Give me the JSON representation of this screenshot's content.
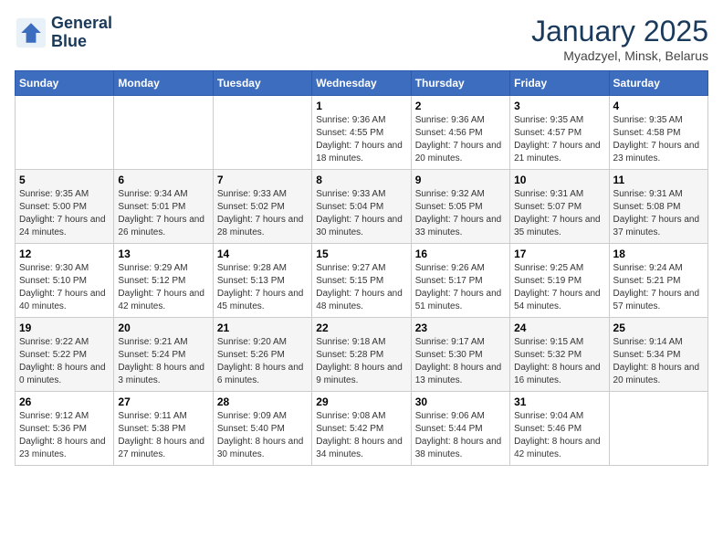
{
  "logo": {
    "line1": "General",
    "line2": "Blue"
  },
  "title": "January 2025",
  "location": "Myadzyel, Minsk, Belarus",
  "weekdays": [
    "Sunday",
    "Monday",
    "Tuesday",
    "Wednesday",
    "Thursday",
    "Friday",
    "Saturday"
  ],
  "weeks": [
    [
      {
        "day": "",
        "sunrise": "",
        "sunset": "",
        "daylight": ""
      },
      {
        "day": "",
        "sunrise": "",
        "sunset": "",
        "daylight": ""
      },
      {
        "day": "",
        "sunrise": "",
        "sunset": "",
        "daylight": ""
      },
      {
        "day": "1",
        "sunrise": "Sunrise: 9:36 AM",
        "sunset": "Sunset: 4:55 PM",
        "daylight": "Daylight: 7 hours and 18 minutes."
      },
      {
        "day": "2",
        "sunrise": "Sunrise: 9:36 AM",
        "sunset": "Sunset: 4:56 PM",
        "daylight": "Daylight: 7 hours and 20 minutes."
      },
      {
        "day": "3",
        "sunrise": "Sunrise: 9:35 AM",
        "sunset": "Sunset: 4:57 PM",
        "daylight": "Daylight: 7 hours and 21 minutes."
      },
      {
        "day": "4",
        "sunrise": "Sunrise: 9:35 AM",
        "sunset": "Sunset: 4:58 PM",
        "daylight": "Daylight: 7 hours and 23 minutes."
      }
    ],
    [
      {
        "day": "5",
        "sunrise": "Sunrise: 9:35 AM",
        "sunset": "Sunset: 5:00 PM",
        "daylight": "Daylight: 7 hours and 24 minutes."
      },
      {
        "day": "6",
        "sunrise": "Sunrise: 9:34 AM",
        "sunset": "Sunset: 5:01 PM",
        "daylight": "Daylight: 7 hours and 26 minutes."
      },
      {
        "day": "7",
        "sunrise": "Sunrise: 9:33 AM",
        "sunset": "Sunset: 5:02 PM",
        "daylight": "Daylight: 7 hours and 28 minutes."
      },
      {
        "day": "8",
        "sunrise": "Sunrise: 9:33 AM",
        "sunset": "Sunset: 5:04 PM",
        "daylight": "Daylight: 7 hours and 30 minutes."
      },
      {
        "day": "9",
        "sunrise": "Sunrise: 9:32 AM",
        "sunset": "Sunset: 5:05 PM",
        "daylight": "Daylight: 7 hours and 33 minutes."
      },
      {
        "day": "10",
        "sunrise": "Sunrise: 9:31 AM",
        "sunset": "Sunset: 5:07 PM",
        "daylight": "Daylight: 7 hours and 35 minutes."
      },
      {
        "day": "11",
        "sunrise": "Sunrise: 9:31 AM",
        "sunset": "Sunset: 5:08 PM",
        "daylight": "Daylight: 7 hours and 37 minutes."
      }
    ],
    [
      {
        "day": "12",
        "sunrise": "Sunrise: 9:30 AM",
        "sunset": "Sunset: 5:10 PM",
        "daylight": "Daylight: 7 hours and 40 minutes."
      },
      {
        "day": "13",
        "sunrise": "Sunrise: 9:29 AM",
        "sunset": "Sunset: 5:12 PM",
        "daylight": "Daylight: 7 hours and 42 minutes."
      },
      {
        "day": "14",
        "sunrise": "Sunrise: 9:28 AM",
        "sunset": "Sunset: 5:13 PM",
        "daylight": "Daylight: 7 hours and 45 minutes."
      },
      {
        "day": "15",
        "sunrise": "Sunrise: 9:27 AM",
        "sunset": "Sunset: 5:15 PM",
        "daylight": "Daylight: 7 hours and 48 minutes."
      },
      {
        "day": "16",
        "sunrise": "Sunrise: 9:26 AM",
        "sunset": "Sunset: 5:17 PM",
        "daylight": "Daylight: 7 hours and 51 minutes."
      },
      {
        "day": "17",
        "sunrise": "Sunrise: 9:25 AM",
        "sunset": "Sunset: 5:19 PM",
        "daylight": "Daylight: 7 hours and 54 minutes."
      },
      {
        "day": "18",
        "sunrise": "Sunrise: 9:24 AM",
        "sunset": "Sunset: 5:21 PM",
        "daylight": "Daylight: 7 hours and 57 minutes."
      }
    ],
    [
      {
        "day": "19",
        "sunrise": "Sunrise: 9:22 AM",
        "sunset": "Sunset: 5:22 PM",
        "daylight": "Daylight: 8 hours and 0 minutes."
      },
      {
        "day": "20",
        "sunrise": "Sunrise: 9:21 AM",
        "sunset": "Sunset: 5:24 PM",
        "daylight": "Daylight: 8 hours and 3 minutes."
      },
      {
        "day": "21",
        "sunrise": "Sunrise: 9:20 AM",
        "sunset": "Sunset: 5:26 PM",
        "daylight": "Daylight: 8 hours and 6 minutes."
      },
      {
        "day": "22",
        "sunrise": "Sunrise: 9:18 AM",
        "sunset": "Sunset: 5:28 PM",
        "daylight": "Daylight: 8 hours and 9 minutes."
      },
      {
        "day": "23",
        "sunrise": "Sunrise: 9:17 AM",
        "sunset": "Sunset: 5:30 PM",
        "daylight": "Daylight: 8 hours and 13 minutes."
      },
      {
        "day": "24",
        "sunrise": "Sunrise: 9:15 AM",
        "sunset": "Sunset: 5:32 PM",
        "daylight": "Daylight: 8 hours and 16 minutes."
      },
      {
        "day": "25",
        "sunrise": "Sunrise: 9:14 AM",
        "sunset": "Sunset: 5:34 PM",
        "daylight": "Daylight: 8 hours and 20 minutes."
      }
    ],
    [
      {
        "day": "26",
        "sunrise": "Sunrise: 9:12 AM",
        "sunset": "Sunset: 5:36 PM",
        "daylight": "Daylight: 8 hours and 23 minutes."
      },
      {
        "day": "27",
        "sunrise": "Sunrise: 9:11 AM",
        "sunset": "Sunset: 5:38 PM",
        "daylight": "Daylight: 8 hours and 27 minutes."
      },
      {
        "day": "28",
        "sunrise": "Sunrise: 9:09 AM",
        "sunset": "Sunset: 5:40 PM",
        "daylight": "Daylight: 8 hours and 30 minutes."
      },
      {
        "day": "29",
        "sunrise": "Sunrise: 9:08 AM",
        "sunset": "Sunset: 5:42 PM",
        "daylight": "Daylight: 8 hours and 34 minutes."
      },
      {
        "day": "30",
        "sunrise": "Sunrise: 9:06 AM",
        "sunset": "Sunset: 5:44 PM",
        "daylight": "Daylight: 8 hours and 38 minutes."
      },
      {
        "day": "31",
        "sunrise": "Sunrise: 9:04 AM",
        "sunset": "Sunset: 5:46 PM",
        "daylight": "Daylight: 8 hours and 42 minutes."
      },
      {
        "day": "",
        "sunrise": "",
        "sunset": "",
        "daylight": ""
      }
    ]
  ]
}
